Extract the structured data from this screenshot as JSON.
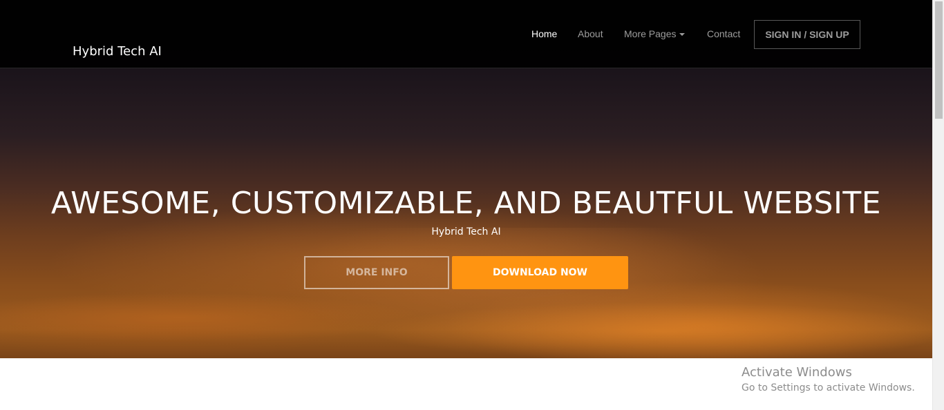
{
  "nav": {
    "brand": "Hybrid Tech AI",
    "links": [
      {
        "label": "Home",
        "active": true
      },
      {
        "label": "About"
      },
      {
        "label": "More Pages",
        "dropdown": true
      },
      {
        "label": "Contact"
      }
    ],
    "signin_label": "SIGN IN / SIGN UP"
  },
  "hero": {
    "title": "AWESOME, CUSTOMIZABLE, AND BEAUTFUL WEBSITE",
    "subtitle": "Hybrid Tech AI",
    "more_info_label": "MORE INFO",
    "download_label": "DOWNLOAD NOW"
  },
  "watermark": {
    "title": "Activate Windows",
    "subtitle": "Go to Settings to activate Windows."
  },
  "colors": {
    "accent": "#ff9411",
    "navbar": "#000000",
    "nav_text": "#9d9d9d"
  }
}
